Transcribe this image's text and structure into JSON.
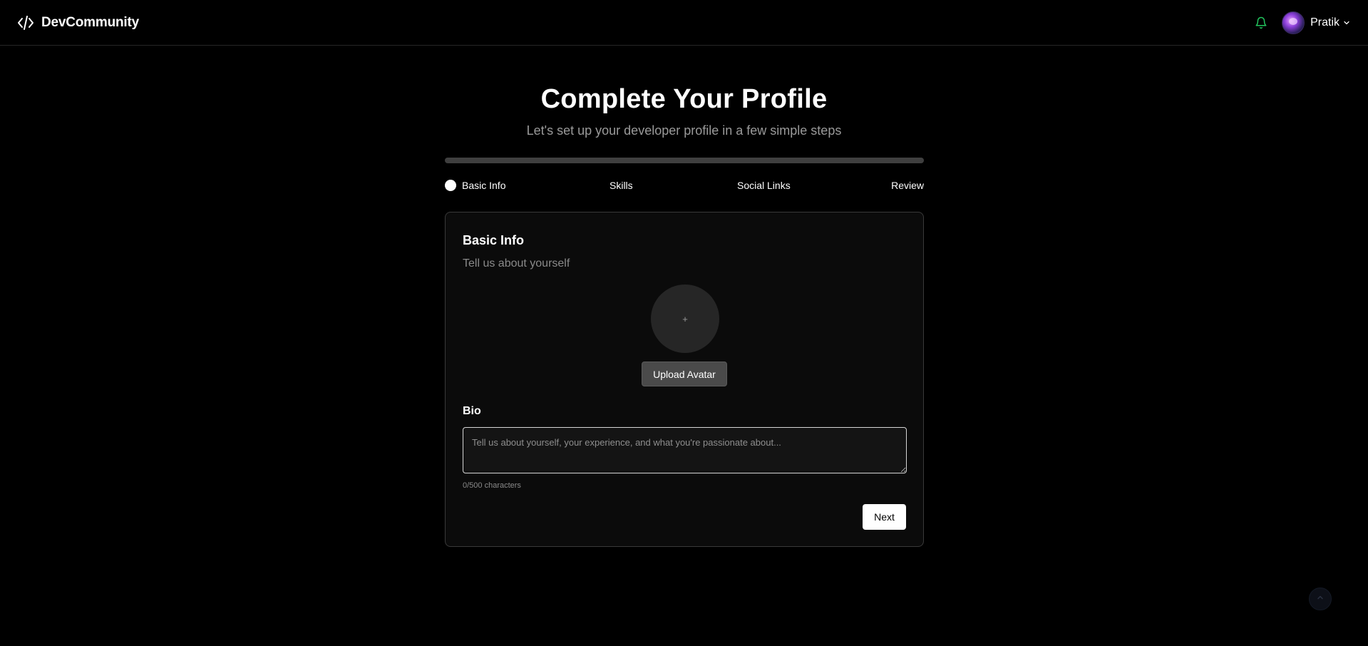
{
  "header": {
    "brand_icon": "code-icon",
    "brand_name": "DevCommunity",
    "notification_icon": "bell-icon",
    "notification_color": "#22c55e",
    "user": {
      "name": "Pratik",
      "menu_icon": "chevron-down-icon"
    }
  },
  "main": {
    "title": "Complete Your Profile",
    "subtitle": "Let's set up your developer profile in a few simple steps",
    "progress_fraction": 0,
    "steps": [
      {
        "label": "Basic Info",
        "active": true
      },
      {
        "label": "Skills",
        "active": false
      },
      {
        "label": "Social Links",
        "active": false
      },
      {
        "label": "Review",
        "active": false
      }
    ]
  },
  "card": {
    "title": "Basic Info",
    "subtitle": "Tell us about yourself",
    "avatar_placeholder": "+",
    "upload_label": "Upload Avatar",
    "bio_label": "Bio",
    "bio_value": "",
    "bio_placeholder": "Tell us about yourself, your experience, and what you're passionate about...",
    "char_count": "0/500 characters",
    "next_label": "Next"
  },
  "scroll_top_icon": "chevron-up-icon"
}
